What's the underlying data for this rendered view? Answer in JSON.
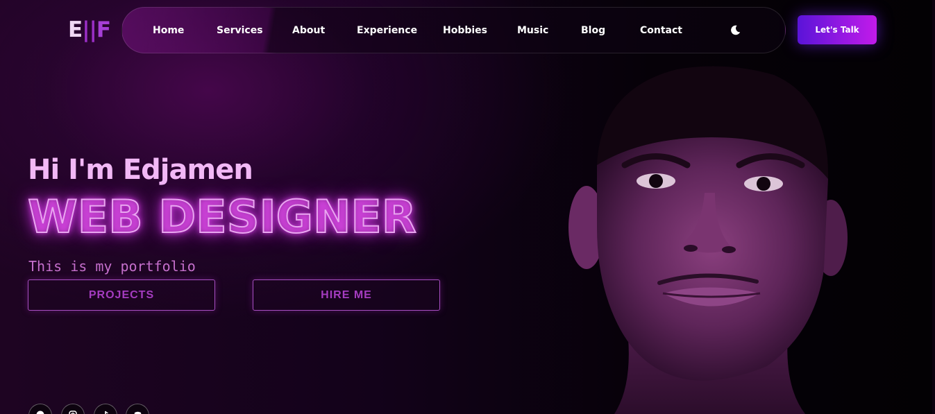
{
  "logo": {
    "left": "E",
    "bar": "||",
    "right": "F"
  },
  "nav": {
    "items": [
      "Home",
      "Services",
      "About",
      "Experience",
      "Hobbies",
      "Music",
      "Blog",
      "Contact"
    ],
    "theme_toggle_icon": "moon-icon"
  },
  "cta": {
    "talk_label": "Let's Talk"
  },
  "hero": {
    "greeting": "Hi I'm Edjamen",
    "role": "WEB DESIGNER",
    "subtitle": "This is my portfolio",
    "projects_label": "PROJECTS",
    "hire_label": "HIRE ME"
  },
  "socials": [
    "facebook-icon",
    "instagram-icon",
    "tiktok-icon",
    "discord-icon"
  ],
  "colors": {
    "accent": "#c21bea",
    "accent_start": "#5a14d8",
    "hero_text": "#f2b8f6",
    "outline": "#a84fc3"
  }
}
